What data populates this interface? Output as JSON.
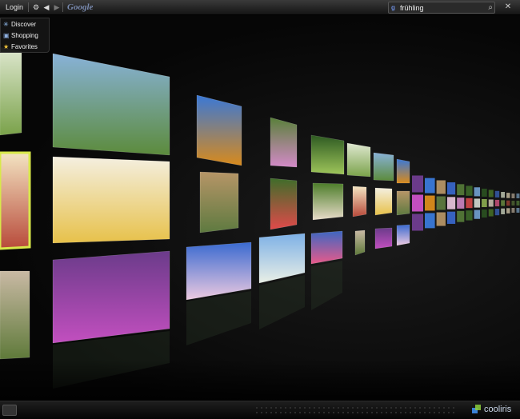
{
  "toolbar": {
    "login_label": "Login",
    "gear_icon": "gear-icon",
    "back_icon": "back-arrow-icon",
    "forward_icon": "forward-arrow-icon",
    "engine_label": "Google",
    "search_value": "frühling",
    "search_icon": "magnifier-icon",
    "close_icon": "close-icon"
  },
  "menu": {
    "items": [
      {
        "label": "Discover",
        "icon": "discover-icon"
      },
      {
        "label": "Shopping",
        "icon": "shopping-bag-icon"
      },
      {
        "label": "Favorites",
        "icon": "star-icon"
      }
    ]
  },
  "wall": {
    "photos": [
      {
        "subject": "garden",
        "colors": [
          "#dfe8d0",
          "#7aa24a"
        ]
      },
      {
        "subject": "map",
        "colors": [
          "#f3e4c2",
          "#b84a3a"
        ]
      },
      {
        "subject": "bench-porch",
        "colors": [
          "#c9b9a4",
          "#5f7a3a"
        ]
      },
      {
        "subject": "lake-town",
        "colors": [
          "#88b2d8",
          "#5c8b3c"
        ]
      },
      {
        "subject": "yellow-flower",
        "colors": [
          "#f4efe0",
          "#e7c14a"
        ]
      },
      {
        "subject": "purple-crocus",
        "colors": [
          "#6b3b8a",
          "#c24fbf"
        ]
      },
      {
        "subject": "autumn-park",
        "colors": [
          "#3a78d6",
          "#d88a1c"
        ]
      },
      {
        "subject": "tree-painting",
        "colors": [
          "#b69567",
          "#5e7a40"
        ]
      },
      {
        "subject": "blossom-tree",
        "colors": [
          "#3a6ad0",
          "#ecc9e0"
        ]
      },
      {
        "subject": "pink-bloom",
        "colors": [
          "#59803a",
          "#d48ac8"
        ]
      },
      {
        "subject": "tulip-field",
        "colors": [
          "#3f6d2a",
          "#e04a4a"
        ]
      },
      {
        "subject": "valley-blossom",
        "colors": [
          "#7db0e6",
          "#e9efe6"
        ]
      },
      {
        "subject": "forest-path",
        "colors": [
          "#2e5a22",
          "#9ec55a"
        ]
      },
      {
        "subject": "dogs-meadow",
        "colors": [
          "#4d7d2a",
          "#e8dcc9"
        ]
      },
      {
        "subject": "lily",
        "colors": [
          "#3d67c2",
          "#e85a8a"
        ]
      }
    ]
  },
  "bottom": {
    "fullscreen_icon": "fullscreen-icon",
    "logo_text": "cooliris",
    "logo_icon": "cooliris-logo-icon"
  }
}
